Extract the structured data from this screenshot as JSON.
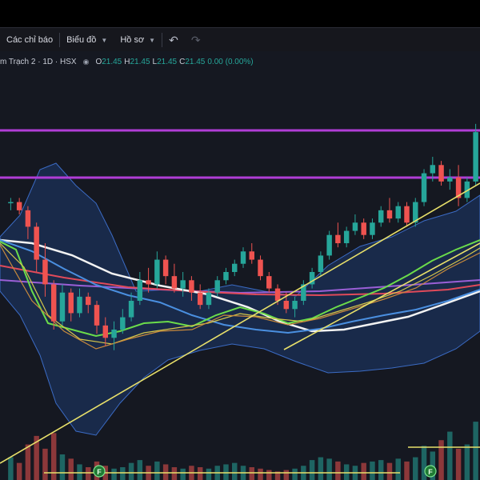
{
  "toolbar": {
    "indicators_label": "Các chỉ báo",
    "chart_type_label": "Biểu đồ",
    "profile_label": "Hồ sơ",
    "undo_icon": "undo-icon",
    "redo_icon": "redo-icon"
  },
  "legend": {
    "symbol": "m Trạch 2 · 1D · HSX",
    "open_key": "O",
    "open": "21.45",
    "high_key": "H",
    "high": "21.45",
    "low_key": "L",
    "low": "21.45",
    "close_key": "C",
    "close": "21.45",
    "change": "0.00 (0.00%)"
  },
  "colors": {
    "up": "#26a69a",
    "down": "#ef5350",
    "background": "#151821",
    "bollinger_fill": "#1e3a6e",
    "purple_lines": "#b03dd6",
    "trend_lines": "#e8e06a"
  },
  "markers": {
    "f1": "F",
    "f2": "F"
  },
  "chart_data": {
    "type": "candlestick",
    "series": [
      {
        "name": "price",
        "values": [
          [
            21.5,
            21.6,
            21.3,
            21.5
          ],
          [
            21.5,
            21.6,
            21.2,
            21.3
          ],
          [
            21.3,
            21.4,
            20.6,
            20.9
          ],
          [
            20.9,
            21.0,
            19.8,
            20.1
          ],
          [
            20.1,
            20.5,
            19.2,
            19.5
          ],
          [
            19.5,
            19.6,
            18.4,
            18.6
          ],
          [
            18.6,
            19.5,
            18.5,
            19.3
          ],
          [
            19.3,
            19.4,
            18.6,
            18.8
          ],
          [
            18.8,
            19.4,
            18.7,
            19.2
          ],
          [
            19.2,
            19.3,
            18.8,
            19.0
          ],
          [
            19.0,
            19.1,
            18.3,
            18.5
          ],
          [
            18.5,
            18.7,
            18.0,
            18.2
          ],
          [
            18.2,
            18.6,
            17.9,
            18.4
          ],
          [
            18.4,
            18.9,
            18.3,
            18.7
          ],
          [
            18.7,
            19.3,
            18.6,
            19.1
          ],
          [
            19.1,
            19.8,
            19.0,
            19.6
          ],
          [
            19.6,
            19.9,
            19.3,
            19.5
          ],
          [
            19.5,
            20.3,
            19.4,
            20.1
          ],
          [
            20.1,
            20.2,
            19.5,
            19.7
          ],
          [
            19.7,
            20.0,
            19.3,
            19.4
          ],
          [
            19.4,
            19.8,
            19.2,
            19.6
          ],
          [
            19.6,
            19.7,
            19.1,
            19.3
          ],
          [
            19.3,
            19.5,
            18.9,
            19.0
          ],
          [
            19.0,
            19.4,
            18.9,
            19.3
          ],
          [
            19.3,
            19.7,
            19.2,
            19.6
          ],
          [
            19.6,
            19.9,
            19.5,
            19.8
          ],
          [
            19.8,
            20.1,
            19.7,
            20.0
          ],
          [
            20.0,
            20.4,
            19.9,
            20.3
          ],
          [
            20.3,
            20.5,
            20.0,
            20.1
          ],
          [
            20.1,
            20.2,
            19.6,
            19.7
          ],
          [
            19.7,
            19.8,
            19.3,
            19.4
          ],
          [
            19.4,
            19.5,
            19.0,
            19.1
          ],
          [
            19.1,
            19.3,
            18.8,
            18.9
          ],
          [
            18.9,
            19.2,
            18.7,
            19.1
          ],
          [
            19.1,
            19.6,
            19.0,
            19.5
          ],
          [
            19.5,
            19.9,
            19.4,
            19.8
          ],
          [
            19.8,
            20.3,
            19.7,
            20.2
          ],
          [
            20.2,
            20.8,
            20.1,
            20.7
          ],
          [
            20.7,
            21.0,
            20.4,
            20.5
          ],
          [
            20.5,
            20.9,
            20.4,
            20.8
          ],
          [
            20.8,
            21.2,
            20.7,
            21.0
          ],
          [
            21.0,
            21.1,
            20.6,
            20.7
          ],
          [
            20.7,
            21.1,
            20.6,
            21.0
          ],
          [
            21.0,
            21.4,
            20.9,
            21.3
          ],
          [
            21.3,
            21.6,
            21.0,
            21.1
          ],
          [
            21.1,
            21.5,
            21.0,
            21.4
          ],
          [
            21.4,
            21.5,
            20.9,
            21.0
          ],
          [
            21.0,
            21.6,
            20.9,
            21.5
          ],
          [
            21.5,
            22.3,
            21.4,
            22.2
          ],
          [
            22.2,
            22.6,
            22.0,
            22.4
          ],
          [
            22.4,
            22.5,
            21.9,
            22.0
          ],
          [
            22.0,
            22.3,
            21.8,
            22.1
          ],
          [
            22.1,
            22.4,
            21.4,
            21.6
          ],
          [
            21.6,
            22.1,
            21.5,
            22.0
          ],
          [
            22.0,
            23.4,
            21.9,
            23.2
          ]
        ]
      }
    ],
    "volume": [
      1.6,
      1.2,
      2.5,
      3.1,
      2.2,
      3.3,
      1.8,
      1.5,
      1.1,
      0.9,
      1.3,
      1.0,
      0.8,
      0.9,
      1.2,
      1.4,
      1.0,
      1.3,
      1.1,
      0.9,
      0.8,
      1.0,
      0.9,
      0.8,
      1.0,
      1.1,
      1.2,
      1.0,
      0.9,
      0.8,
      0.7,
      0.6,
      0.7,
      0.8,
      1.0,
      1.4,
      1.6,
      1.5,
      1.3,
      1.1,
      1.0,
      1.2,
      1.3,
      1.4,
      1.2,
      1.5,
      1.3,
      1.6,
      2.4,
      2.0,
      2.8,
      3.4,
      2.2,
      2.5,
      4.1
    ]
  }
}
